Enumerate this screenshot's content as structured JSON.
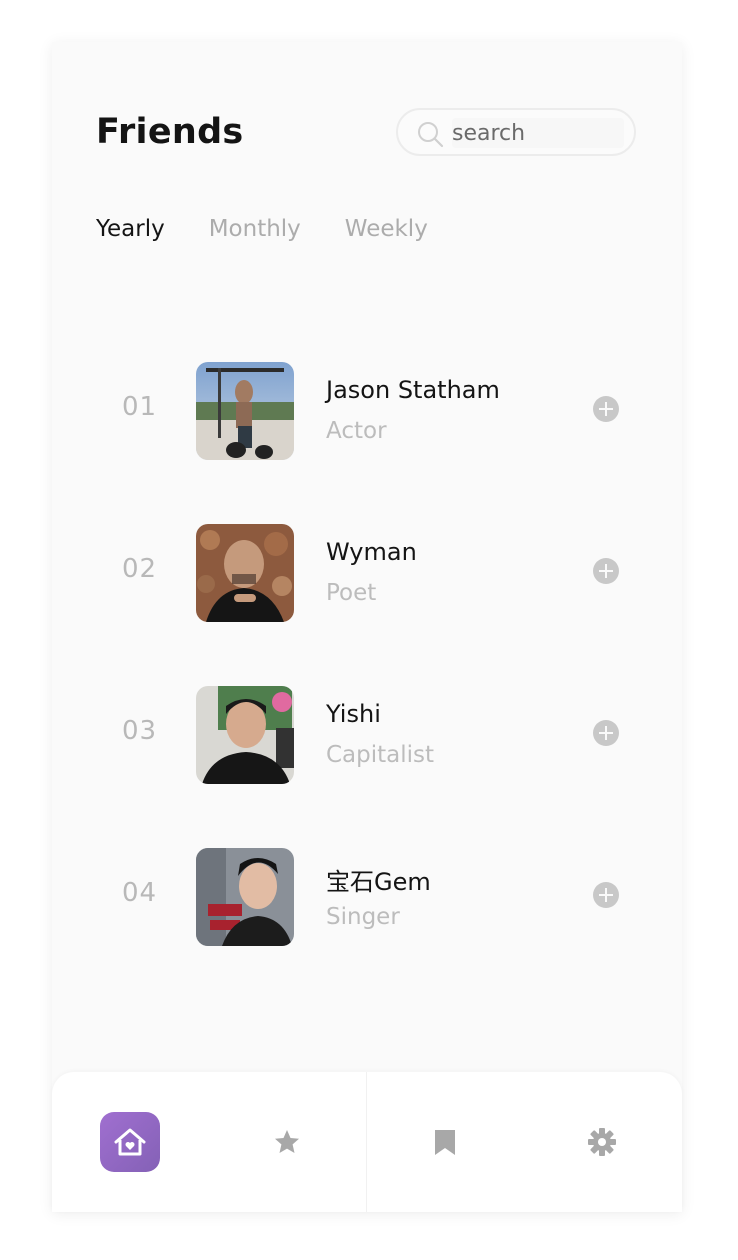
{
  "header": {
    "title": "Friends"
  },
  "search": {
    "placeholder": "search",
    "icon": "search-icon"
  },
  "tabs": [
    {
      "label": "Yearly",
      "active": true
    },
    {
      "label": "Monthly",
      "active": false
    },
    {
      "label": "Weekly",
      "active": false
    }
  ],
  "friends": [
    {
      "rank": "01",
      "name": "Jason Statham",
      "role": "Actor"
    },
    {
      "rank": "02",
      "name": "Wyman",
      "role": "Poet"
    },
    {
      "rank": "03",
      "name": "Yishi",
      "role": "Capitalist"
    },
    {
      "rank": "04",
      "name": "宝石Gem",
      "role": "Singer"
    }
  ],
  "bottom_nav": [
    {
      "icon": "home-heart-icon",
      "active": true
    },
    {
      "icon": "star-icon",
      "active": false
    },
    {
      "icon": "bookmark-icon",
      "active": false
    },
    {
      "icon": "gear-icon",
      "active": false
    }
  ],
  "colors": {
    "accent": "#9468c6",
    "muted": "#acacac",
    "text": "#141414"
  }
}
